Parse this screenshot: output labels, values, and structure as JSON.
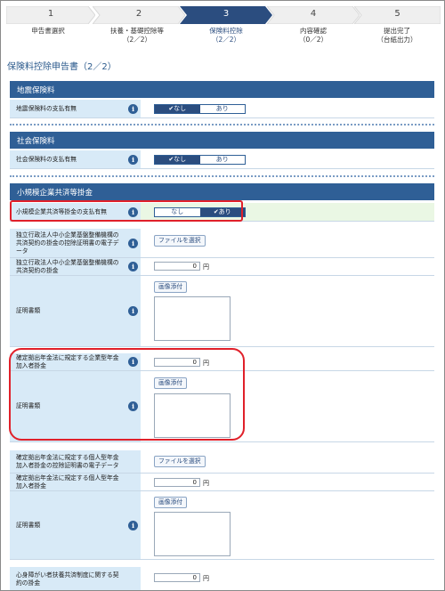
{
  "steps": [
    {
      "num": "1",
      "label": "申告書選択",
      "sub": ""
    },
    {
      "num": "2",
      "label": "扶養・基礎控除等",
      "sub": "（2／2）"
    },
    {
      "num": "3",
      "label": "保険料控除",
      "sub": "（2／2）"
    },
    {
      "num": "4",
      "label": "内容確認",
      "sub": "（0／2）"
    },
    {
      "num": "5",
      "label": "提出完了",
      "sub": "（台紙出力）"
    }
  ],
  "page_title": "保険料控除申告書（2／2）",
  "info_glyph": "i",
  "sections": {
    "earthquake": {
      "title": "地震保険料",
      "row_label": "地震保険料の支払有無",
      "options": [
        "✔なし",
        "あり"
      ]
    },
    "social": {
      "title": "社会保険料",
      "row_label": "社会保険料の支払有無",
      "options": [
        "✔なし",
        "あり"
      ]
    },
    "small_biz": {
      "title": "小規模企業共済等掛金",
      "pay_label": "小規模企業共済等掛金の支払有無",
      "options": [
        "なし",
        "✔あり"
      ],
      "cert_edata_label": "独立行政法人中小企業基盤整備機構の共済契約の掛金の控除証明書の電子データ",
      "file_button": "ファイルを選択",
      "kyosai_label": "独立行政法人中小企業基盤整備機構の共済契約の掛金",
      "kyosai_value": "0",
      "yen": "円",
      "cert_label": "証明書類",
      "image_button": "画像添付",
      "corp_dc_label": "確定拠出年金法に規定する企業型年金加入者掛金",
      "corp_dc_value": "0",
      "corp_cert_label": "証明書類",
      "indiv_edata_label": "確定拠出年金法に規定する個人型年金加入者掛金の控除証明書の電子データ",
      "indiv_file_button": "ファイルを選択",
      "indiv_dc_label": "確定拠出年金法に規定する個人型年金加入者掛金",
      "indiv_dc_value": "0",
      "indiv_cert_label": "証明書類",
      "disability_label": "心身障がい者扶養共済制度に関する契約の掛金",
      "disability_value": "0"
    }
  },
  "colors": {
    "header_blue": "#2f5f96",
    "label_bg": "#d8eaf7",
    "highlight_green": "#eaf7e4",
    "annotation_red": "#e0202a"
  }
}
